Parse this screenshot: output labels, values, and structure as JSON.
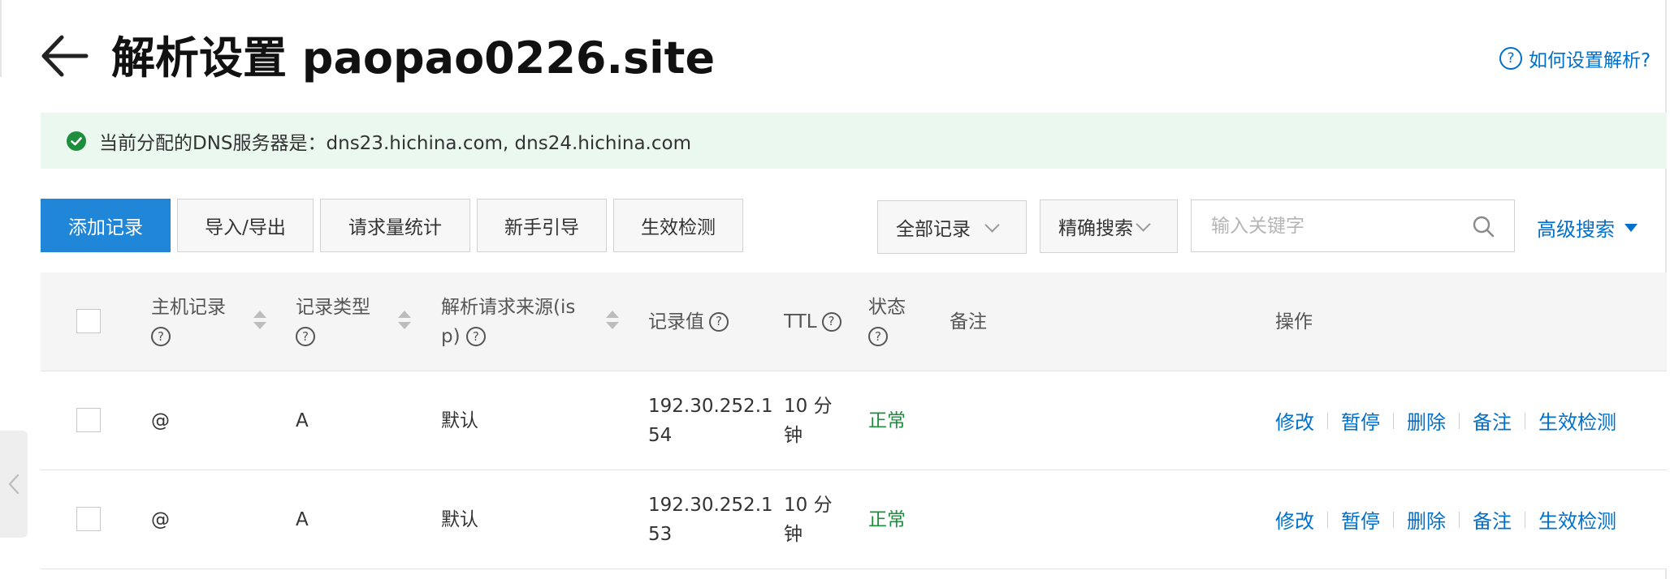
{
  "header": {
    "title": "解析设置 paopao0226.site",
    "help_link": "如何设置解析?",
    "help_icon_text": "?"
  },
  "notice": {
    "text": "当前分配的DNS服务器是：dns23.hichina.com, dns24.hichina.com",
    "status": "success"
  },
  "toolbar": {
    "add_record": "添加记录",
    "import_export": "导入/导出",
    "request_stats": "请求量统计",
    "beginner_guide": "新手引导",
    "effect_check": "生效检测",
    "record_filter": "全部记录",
    "search_mode": "精确搜索",
    "search_placeholder": "输入关键字",
    "advanced_search": "高级搜索"
  },
  "table": {
    "columns": {
      "host": "主机记录",
      "type": "记录类型",
      "isp": "解析请求来源(isp)",
      "isp_line1": "解析请求来源(is",
      "isp_line2": "p)",
      "value": "记录值",
      "ttl": "TTL",
      "status": "状态",
      "remark": "备注",
      "actions": "操作"
    },
    "rows": [
      {
        "host": "@",
        "type": "A",
        "isp": "默认",
        "value_line1": "192.30.252.1",
        "value_line2": "54",
        "ttl_line1": "10 分",
        "ttl_line2": "钟",
        "status": "正常",
        "remark": ""
      },
      {
        "host": "@",
        "type": "A",
        "isp": "默认",
        "value_line1": "192.30.252.1",
        "value_line2": "53",
        "ttl_line1": "10 分",
        "ttl_line2": "钟",
        "status": "正常",
        "remark": ""
      }
    ],
    "row_actions": {
      "edit": "修改",
      "pause": "暂停",
      "delete": "删除",
      "remark": "备注",
      "effect_check": "生效检测"
    }
  },
  "colors": {
    "primary": "#1f86d8",
    "link": "#0070cc",
    "success": "#1e8e3e",
    "notice_bg": "#ebf8ef"
  },
  "icons": [
    "back-arrow-icon",
    "help-icon",
    "check-circle-icon",
    "chevron-down-icon",
    "search-icon",
    "caret-down-icon",
    "sort-icon",
    "question-icon",
    "chevron-left-icon"
  ]
}
